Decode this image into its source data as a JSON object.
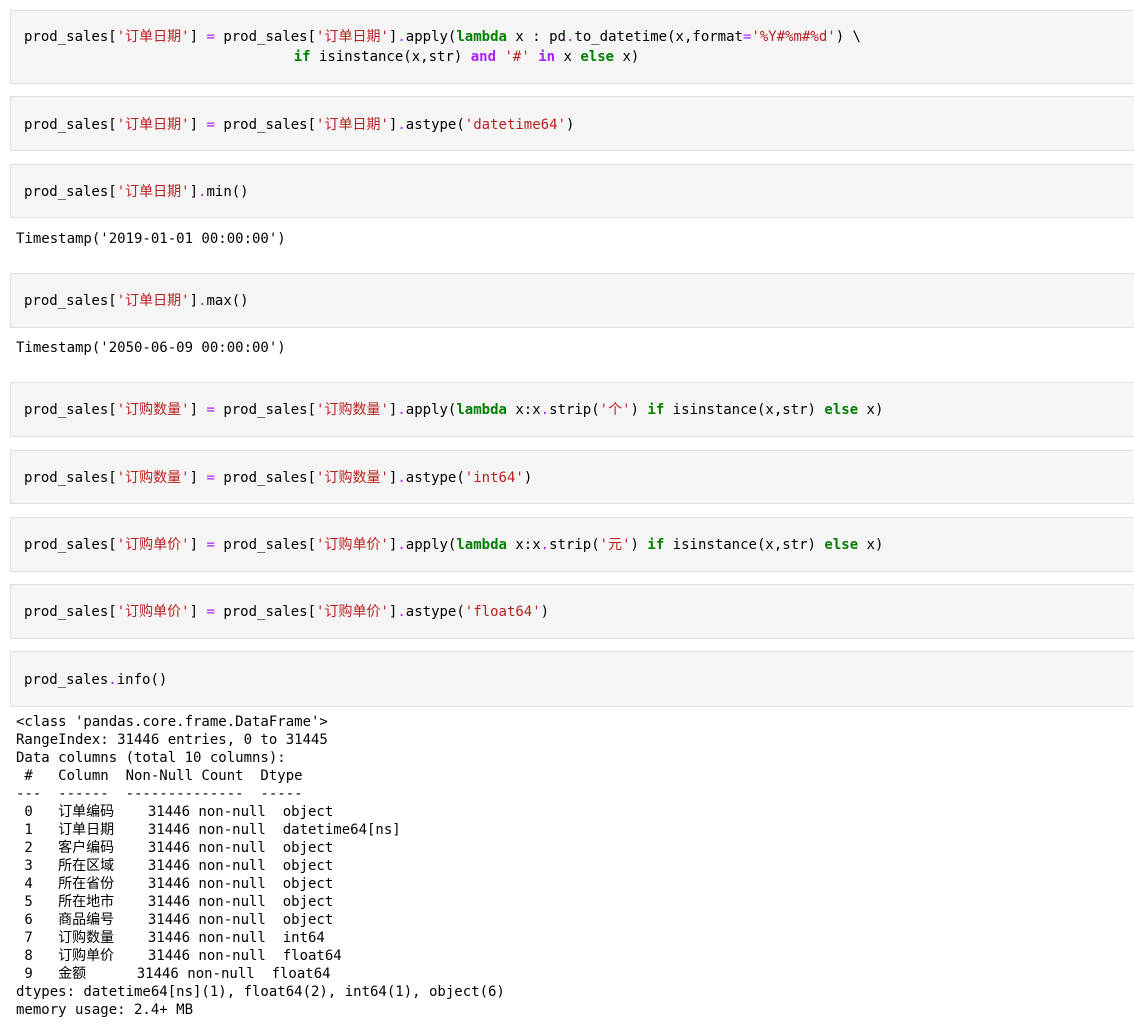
{
  "cells": [
    {
      "lines": [
        [
          [
            "v",
            "prod_sales"
          ],
          [
            "p",
            "["
          ],
          [
            "s",
            "'订单日期'"
          ],
          [
            "p",
            "] "
          ],
          [
            "o",
            "="
          ],
          [
            "v",
            " prod_sales"
          ],
          [
            "p",
            "["
          ],
          [
            "s",
            "'订单日期'"
          ],
          [
            "p",
            "]"
          ],
          [
            "o",
            "."
          ],
          [
            "v",
            "apply("
          ],
          [
            "k",
            "lambda"
          ],
          [
            "v",
            " x : pd"
          ],
          [
            "o",
            "."
          ],
          [
            "v",
            "to_datetime(x,format"
          ],
          [
            "o",
            "="
          ],
          [
            "s",
            "'%Y#%m#%d'"
          ],
          [
            "v",
            ") \\"
          ]
        ],
        [
          [
            "v",
            "                                "
          ],
          [
            "k",
            "if"
          ],
          [
            "v",
            " isinstance(x,str) "
          ],
          [
            "ow",
            "and"
          ],
          [
            "v",
            " "
          ],
          [
            "s",
            "'#'"
          ],
          [
            "v",
            " "
          ],
          [
            "ow",
            "in"
          ],
          [
            "v",
            " x "
          ],
          [
            "k",
            "else"
          ],
          [
            "v",
            " x)"
          ]
        ]
      ]
    },
    {
      "lines": [
        [
          [
            "v",
            "prod_sales"
          ],
          [
            "p",
            "["
          ],
          [
            "s",
            "'订单日期'"
          ],
          [
            "p",
            "] "
          ],
          [
            "o",
            "="
          ],
          [
            "v",
            " prod_sales"
          ],
          [
            "p",
            "["
          ],
          [
            "s",
            "'订单日期'"
          ],
          [
            "p",
            "]"
          ],
          [
            "o",
            "."
          ],
          [
            "v",
            "astype("
          ],
          [
            "s",
            "'datetime64'"
          ],
          [
            "v",
            ")"
          ]
        ]
      ]
    },
    {
      "lines": [
        [
          [
            "v",
            "prod_sales"
          ],
          [
            "p",
            "["
          ],
          [
            "s",
            "'订单日期'"
          ],
          [
            "p",
            "]"
          ],
          [
            "o",
            "."
          ],
          [
            "v",
            "min()"
          ]
        ]
      ],
      "output": "Timestamp('2019-01-01 00:00:00')"
    },
    {
      "lines": [
        [
          [
            "v",
            "prod_sales"
          ],
          [
            "p",
            "["
          ],
          [
            "s",
            "'订单日期'"
          ],
          [
            "p",
            "]"
          ],
          [
            "o",
            "."
          ],
          [
            "v",
            "max()"
          ]
        ]
      ],
      "output": "Timestamp('2050-06-09 00:00:00')"
    },
    {
      "lines": [
        [
          [
            "v",
            "prod_sales"
          ],
          [
            "p",
            "["
          ],
          [
            "s",
            "'订购数量'"
          ],
          [
            "p",
            "] "
          ],
          [
            "o",
            "="
          ],
          [
            "v",
            " prod_sales"
          ],
          [
            "p",
            "["
          ],
          [
            "s",
            "'订购数量'"
          ],
          [
            "p",
            "]"
          ],
          [
            "o",
            "."
          ],
          [
            "v",
            "apply("
          ],
          [
            "k",
            "lambda"
          ],
          [
            "v",
            " x:x"
          ],
          [
            "o",
            "."
          ],
          [
            "v",
            "strip("
          ],
          [
            "s",
            "'个'"
          ],
          [
            "v",
            ") "
          ],
          [
            "k",
            "if"
          ],
          [
            "v",
            " isinstance(x,str) "
          ],
          [
            "k",
            "else"
          ],
          [
            "v",
            " x)"
          ]
        ]
      ]
    },
    {
      "lines": [
        [
          [
            "v",
            "prod_sales"
          ],
          [
            "p",
            "["
          ],
          [
            "s",
            "'订购数量'"
          ],
          [
            "p",
            "] "
          ],
          [
            "o",
            "="
          ],
          [
            "v",
            " prod_sales"
          ],
          [
            "p",
            "["
          ],
          [
            "s",
            "'订购数量'"
          ],
          [
            "p",
            "]"
          ],
          [
            "o",
            "."
          ],
          [
            "v",
            "astype("
          ],
          [
            "s",
            "'int64'"
          ],
          [
            "v",
            ")"
          ]
        ]
      ]
    },
    {
      "lines": [
        [
          [
            "v",
            "prod_sales"
          ],
          [
            "p",
            "["
          ],
          [
            "s",
            "'订购单价'"
          ],
          [
            "p",
            "] "
          ],
          [
            "o",
            "="
          ],
          [
            "v",
            " prod_sales"
          ],
          [
            "p",
            "["
          ],
          [
            "s",
            "'订购单价'"
          ],
          [
            "p",
            "]"
          ],
          [
            "o",
            "."
          ],
          [
            "v",
            "apply("
          ],
          [
            "k",
            "lambda"
          ],
          [
            "v",
            " x:x"
          ],
          [
            "o",
            "."
          ],
          [
            "v",
            "strip("
          ],
          [
            "s",
            "'元'"
          ],
          [
            "v",
            ") "
          ],
          [
            "k",
            "if"
          ],
          [
            "v",
            " isinstance(x,str) "
          ],
          [
            "k",
            "else"
          ],
          [
            "v",
            " x)"
          ]
        ]
      ]
    },
    {
      "lines": [
        [
          [
            "v",
            "prod_sales"
          ],
          [
            "p",
            "["
          ],
          [
            "s",
            "'订购单价'"
          ],
          [
            "p",
            "] "
          ],
          [
            "o",
            "="
          ],
          [
            "v",
            " prod_sales"
          ],
          [
            "p",
            "["
          ],
          [
            "s",
            "'订购单价'"
          ],
          [
            "p",
            "]"
          ],
          [
            "o",
            "."
          ],
          [
            "v",
            "astype("
          ],
          [
            "s",
            "'float64'"
          ],
          [
            "v",
            ")"
          ]
        ]
      ]
    },
    {
      "lines": [
        [
          [
            "v",
            "prod_sales"
          ],
          [
            "o",
            "."
          ],
          [
            "v",
            "info()"
          ]
        ]
      ]
    }
  ],
  "info_output": [
    "<class 'pandas.core.frame.DataFrame'>",
    "RangeIndex: 31446 entries, 0 to 31445",
    "Data columns (total 10 columns):",
    " #   Column  Non-Null Count  Dtype",
    "---  ------  --------------  -----",
    " 0   订单编码    31446 non-null  object",
    " 1   订单日期    31446 non-null  datetime64[ns]",
    " 2   客户编码    31446 non-null  object",
    " 3   所在区域    31446 non-null  object",
    " 4   所在省份    31446 non-null  object",
    " 5   所在地市    31446 non-null  object",
    " 6   商品编号    31446 non-null  object",
    " 7   订购数量    31446 non-null  int64",
    " 8   订购单价    31446 non-null  float64",
    " 9   金额      31446 non-null  float64",
    "dtypes: datetime64[ns](1), float64(2), int64(1), object(6)",
    "memory usage: 2.4+ MB"
  ]
}
